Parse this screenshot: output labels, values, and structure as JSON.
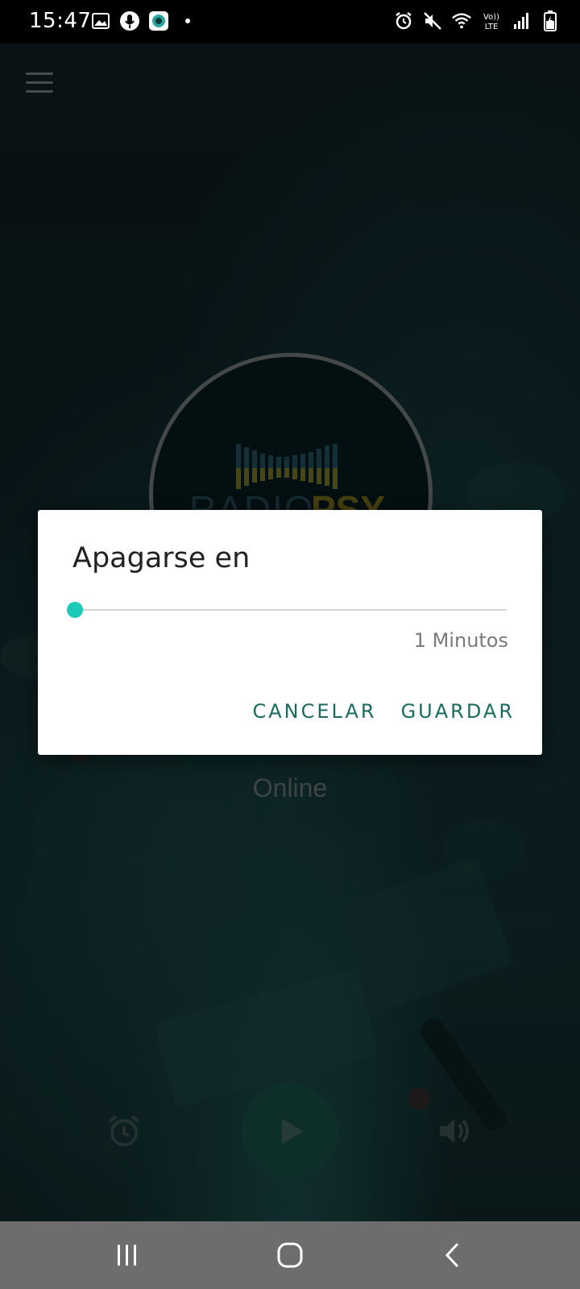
{
  "status_bar": {
    "time": "15:47",
    "left_icons": [
      "image-icon",
      "microphone-icon",
      "app-notification-icon",
      "dot-icon"
    ],
    "right_icons": [
      "alarm-icon",
      "mute-icon",
      "wifi-icon",
      "volte-icon",
      "signal-icon",
      "battery-charging-icon"
    ],
    "volte_label": "Vo)) LTE"
  },
  "app": {
    "menu_icon": "hamburger-menu-icon",
    "logo_text": "RADIO PSY",
    "status_text": "Online",
    "controls": {
      "alarm_icon": "alarm-clock-icon",
      "play_icon": "play-icon",
      "volume_icon": "volume-icon"
    }
  },
  "dialog": {
    "title": "Apagarse en",
    "slider": {
      "value": 1,
      "min": 1,
      "fraction": 0.0
    },
    "value_label": "1 Minutos",
    "cancel_label": "CANCELAR",
    "save_label": "GUARDAR"
  },
  "nav_bar": {
    "icons": [
      "recent-apps-icon",
      "home-icon",
      "back-icon"
    ]
  },
  "colors": {
    "accent": "#1dc9b7",
    "button_text": "#1a6b5e",
    "play_button": "#16493f"
  }
}
